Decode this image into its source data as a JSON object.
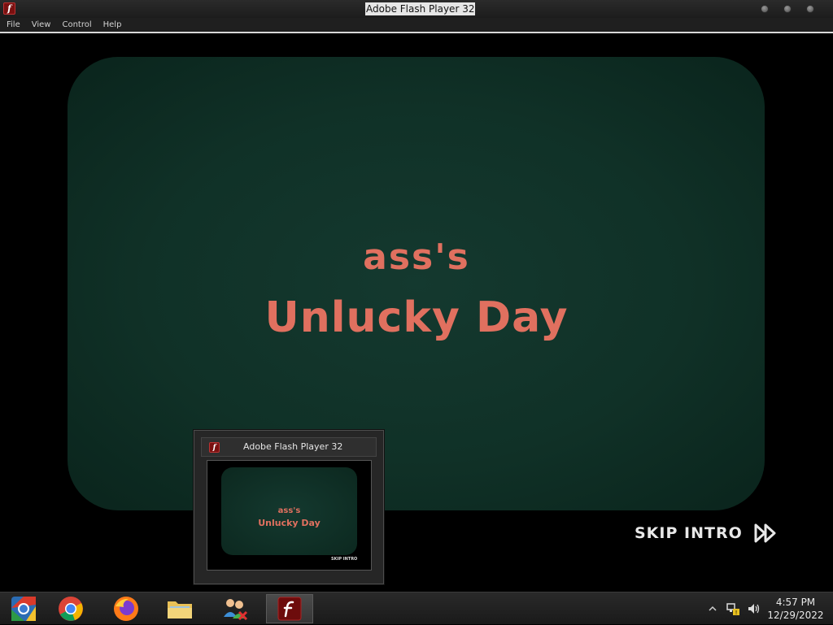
{
  "window": {
    "title": "Adobe Flash Player 32",
    "app_icon": "flash-player-icon",
    "app_icon_glyph": "f"
  },
  "menu": {
    "items": [
      "File",
      "View",
      "Control",
      "Help"
    ]
  },
  "content": {
    "title_line1": "ass's",
    "title_line2": "Unlucky Day",
    "skip_label": "SKIP INTRO",
    "skip_icon": "fast-forward-icon",
    "title_color": "#e0705f",
    "panel_color": "#103127"
  },
  "thumbnail": {
    "title": "Adobe Flash Player 32",
    "line1": "ass's",
    "line2": "Unlucky Day",
    "skip_label": "SKIP INTRO"
  },
  "taskbar": {
    "apps": [
      {
        "name": "chromium",
        "icon": "chromium-icon"
      },
      {
        "name": "chrome",
        "icon": "chrome-icon"
      },
      {
        "name": "firefox",
        "icon": "firefox-icon"
      },
      {
        "name": "file-explorer",
        "icon": "folder-icon"
      },
      {
        "name": "network-app",
        "icon": "people-network-icon"
      },
      {
        "name": "flash-player",
        "icon": "flash-player-icon",
        "active": true
      }
    ],
    "tray_icons": [
      "show-hidden-icons-icon",
      "network-icon",
      "volume-icon"
    ],
    "time": "4:57 PM",
    "date": "12/29/2022"
  }
}
